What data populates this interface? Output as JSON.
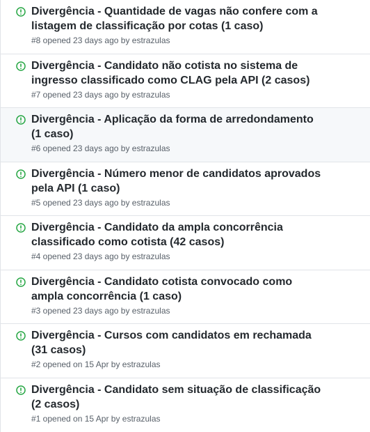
{
  "colors": {
    "open_icon": "#28a745",
    "title": "#24292e",
    "meta": "#586069",
    "border": "#e1e4e8",
    "hover_bg": "#f6f8fa"
  },
  "issues": [
    {
      "title": "Divergência - Quantidade de vagas não confere com a listagem de classificação por cotas (1 caso)",
      "meta_prefix": "#8 opened 23 days ago by",
      "author": "estrazulas",
      "icon": "issue-opened-icon"
    },
    {
      "title": "Divergência - Candidato não cotista no sistema de ingresso classificado como CLAG pela API (2 casos)",
      "meta_prefix": "#7 opened 23 days ago by",
      "author": "estrazulas",
      "icon": "issue-opened-icon"
    },
    {
      "title": "Divergência - Aplicação da forma de arredondamento (1 caso)",
      "meta_prefix": "#6 opened 23 days ago by",
      "author": "estrazulas",
      "icon": "issue-opened-icon"
    },
    {
      "title": "Divergência - Número menor de candidatos aprovados pela API (1 caso)",
      "meta_prefix": "#5 opened 23 days ago by",
      "author": "estrazulas",
      "icon": "issue-opened-icon"
    },
    {
      "title": "Divergência - Candidato da ampla concorrência classificado como cotista (42 casos)",
      "meta_prefix": "#4 opened 23 days ago by",
      "author": "estrazulas",
      "icon": "issue-opened-icon"
    },
    {
      "title": "Divergência - Candidato cotista convocado como ampla concorrência (1 caso)",
      "meta_prefix": "#3 opened 23 days ago by",
      "author": "estrazulas",
      "icon": "issue-opened-icon"
    },
    {
      "title": "Divergência - Cursos com candidatos em rechamada (31 casos)",
      "meta_prefix": "#2 opened on 15 Apr by",
      "author": "estrazulas",
      "icon": "issue-opened-icon"
    },
    {
      "title": "Divergência - Candidato sem situação de classificação (2 casos)",
      "meta_prefix": "#1 opened on 15 Apr by",
      "author": "estrazulas",
      "icon": "issue-opened-icon"
    }
  ]
}
